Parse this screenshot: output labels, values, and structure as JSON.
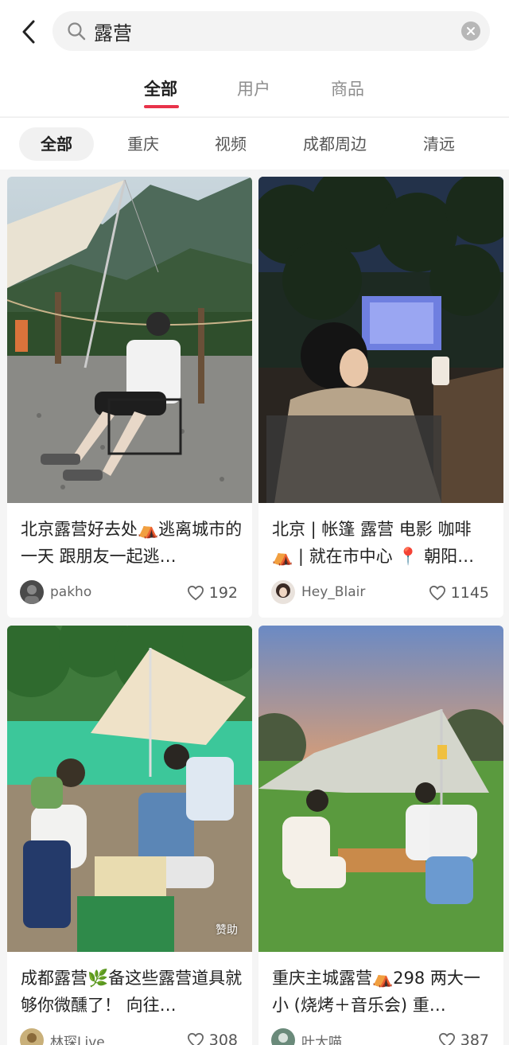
{
  "search": {
    "query": "露营"
  },
  "tabs": [
    {
      "label": "全部"
    },
    {
      "label": "用户"
    },
    {
      "label": "商品"
    }
  ],
  "filters": [
    {
      "label": "全部"
    },
    {
      "label": "重庆"
    },
    {
      "label": "视频"
    },
    {
      "label": "成都周边"
    },
    {
      "label": "清远"
    }
  ],
  "posts": [
    {
      "title": "北京露营好去处⛺逃离城市的一天 跟朋友一起逃…",
      "author": "pakho",
      "likes": "192"
    },
    {
      "title": "北京 | 帐篷 露营 电影 咖啡 ⛺ | 就在市中心 📍 朝阳…",
      "author": "Hey_Blair",
      "likes": "1145"
    },
    {
      "title": "成都露营🌿备这些露营道具就够你微醺了！ 向往…",
      "author": "林琛Live",
      "likes": "308",
      "badge": "赞助"
    },
    {
      "title": "重庆主城露营⛺298 两大一小 (烧烤＋音乐会) 重…",
      "author": "叶大喵",
      "likes": "387"
    }
  ],
  "colors": {
    "accent": "#e8334a",
    "background": "#f5f5f5"
  }
}
